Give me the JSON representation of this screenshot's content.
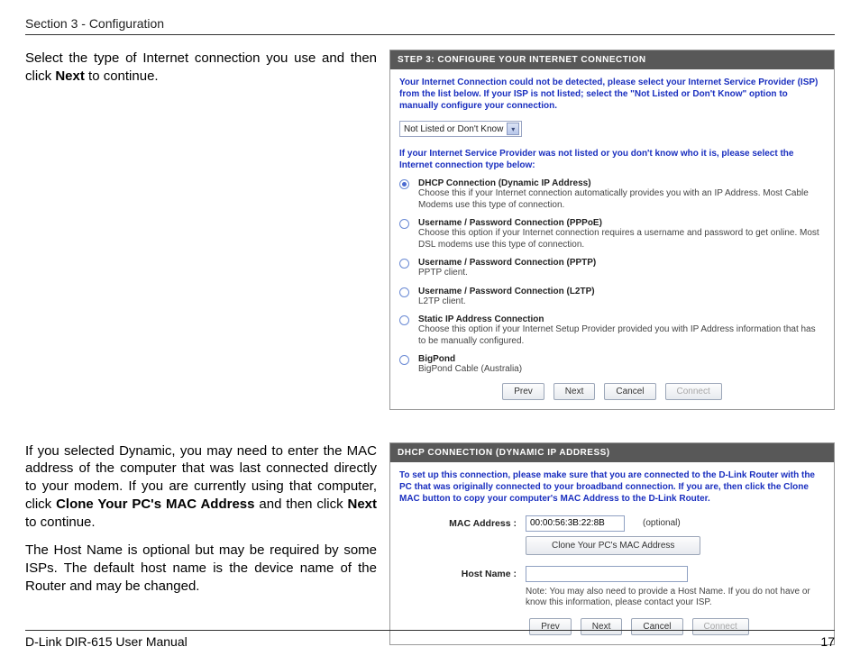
{
  "header": {
    "section": "Section 3 - Configuration"
  },
  "footer": {
    "manual": "D-Link DIR-615 User Manual",
    "page": "17"
  },
  "block1": {
    "text_pre": "Select the type of Internet connection you use and then click ",
    "text_bold": "Next",
    "text_post": " to continue."
  },
  "panel1": {
    "title": "STEP 3: CONFIGURE YOUR INTERNET CONNECTION",
    "intro": "Your Internet Connection could not be detected, please select your Internet Service Provider (ISP) from the list below. If your ISP is not listed; select the \"Not Listed or Don't Know\" option to manually configure your connection.",
    "select_value": "Not Listed or Don't Know",
    "sub_intro": "If your Internet Service Provider was not listed or you don't know who it is, please select the Internet connection type below:",
    "options": [
      {
        "title": "DHCP Connection (Dynamic IP Address)",
        "sub": "Choose this if your Internet connection automatically provides you with an IP Address. Most Cable Modems use this type of connection.",
        "selected": true
      },
      {
        "title": "Username / Password Connection (PPPoE)",
        "sub": "Choose this option if your Internet connection requires a username and password to get online. Most DSL modems use this type of connection.",
        "selected": false
      },
      {
        "title": "Username / Password Connection (PPTP)",
        "sub": "PPTP client.",
        "selected": false
      },
      {
        "title": "Username / Password Connection (L2TP)",
        "sub": "L2TP client.",
        "selected": false
      },
      {
        "title": "Static IP Address Connection",
        "sub": "Choose this option if your Internet Setup Provider provided you with IP Address information that has to be manually configured.",
        "selected": false
      },
      {
        "title": "BigPond",
        "sub": "BigPond Cable (Australia)",
        "selected": false
      }
    ],
    "buttons": {
      "prev": "Prev",
      "next": "Next",
      "cancel": "Cancel",
      "connect": "Connect"
    }
  },
  "block2": {
    "p1_pre": "If you selected Dynamic, you may need to enter the MAC address of the computer that was last connected directly to your modem. If you are currently using that computer, click ",
    "p1_bold1": "Clone Your PC's MAC Address",
    "p1_mid": " and then click ",
    "p1_bold2": "Next",
    "p1_post": " to continue.",
    "p2": "The Host Name is optional but may be required by some ISPs. The default host name is the device name of the Router and may be changed."
  },
  "panel2": {
    "title": "DHCP CONNECTION (DYNAMIC IP ADDRESS)",
    "intro": "To set up this connection, please make sure that you are connected to the D-Link Router with the PC that was originally connected to your broadband connection. If you are, then click the Clone MAC button to copy your computer's MAC Address to the D-Link Router.",
    "mac_label": "MAC Address :",
    "mac_value": "00:00:56:3B:22:8B",
    "mac_optional": "(optional)",
    "clone_btn": "Clone Your PC's MAC Address",
    "host_label": "Host Name :",
    "host_value": "",
    "note": "Note: You may also need to provide a Host Name. If you do not have or know this information, please contact your ISP.",
    "buttons": {
      "prev": "Prev",
      "next": "Next",
      "cancel": "Cancel",
      "connect": "Connect"
    }
  }
}
